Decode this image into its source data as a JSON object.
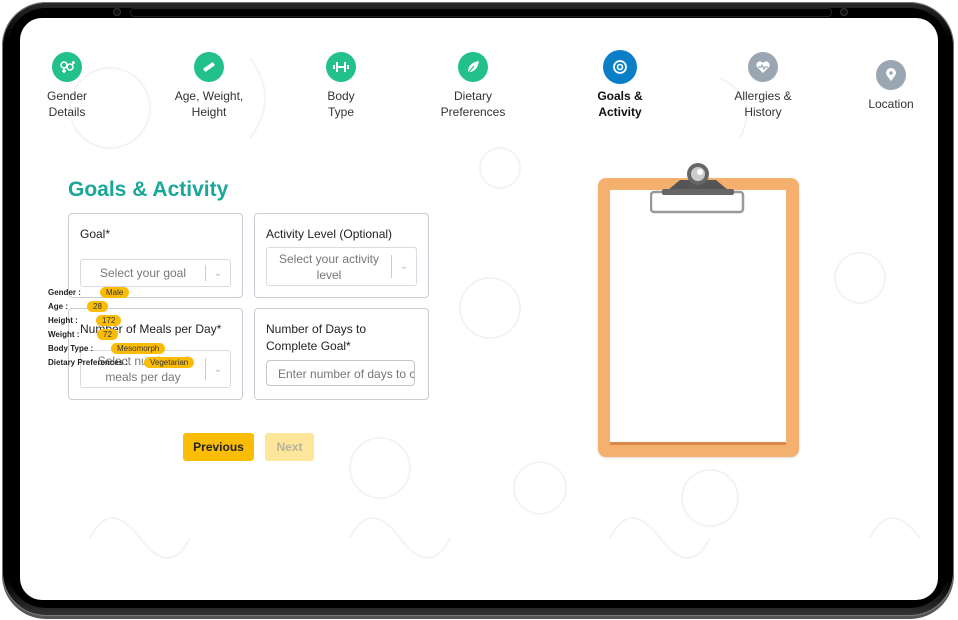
{
  "stepper": {
    "steps": [
      {
        "label": "Gender\nDetails",
        "icon": "gender-icon",
        "state": "done"
      },
      {
        "label": "Age, Weight,\nHeight",
        "icon": "ruler-icon",
        "state": "done"
      },
      {
        "label": "Body\nType",
        "icon": "dumbbell-icon",
        "state": "done"
      },
      {
        "label": "Dietary\nPreferences",
        "icon": "leaf-icon",
        "state": "done"
      },
      {
        "label": "Goals &\nActivity",
        "icon": "target-icon",
        "state": "active"
      },
      {
        "label": "Allergies &\nHistory",
        "icon": "heartbeat-icon",
        "state": "todo"
      },
      {
        "label": "Location",
        "icon": "location-pin-icon",
        "state": "todo"
      }
    ]
  },
  "form": {
    "title": "Goals & Activity",
    "goal": {
      "label": "Goal*",
      "placeholder": "Select your goal"
    },
    "activity": {
      "label": "Activity Level (Optional)",
      "placeholder": "Select your activity level"
    },
    "meals": {
      "label": "Number of Meals per Day*",
      "placeholder": "Select number of meals per day"
    },
    "days": {
      "label": "Number of Days to Complete Goal*",
      "placeholder": "Enter number of days to c"
    }
  },
  "buttons": {
    "previous": "Previous",
    "next": "Next"
  },
  "summary": {
    "rows": [
      {
        "label": "Gender :",
        "value": "Male"
      },
      {
        "label": "Age :",
        "value": "28"
      },
      {
        "label": "Height :",
        "value": "172"
      },
      {
        "label": "Weight :",
        "value": "72"
      },
      {
        "label": "Body Type :",
        "value": "Mesomorph"
      },
      {
        "label": "Dietary Preferences :",
        "value": "Vegetarian"
      }
    ]
  },
  "colors": {
    "primary": "#22c08a",
    "active": "#0a7fc8",
    "pending": "#9aa7b3",
    "accent": "#fbbc05",
    "title": "#1aa79a",
    "clipboard": "#f4b06e"
  }
}
